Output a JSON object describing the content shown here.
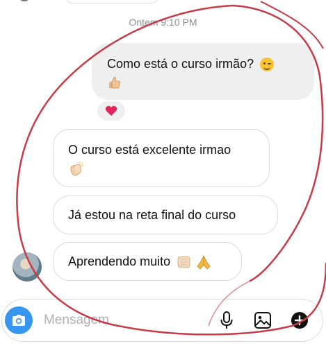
{
  "timestamp": "Ontem 9:10 PM",
  "messages": [
    {
      "direction": "sent",
      "text": "Como está o curso irmão?",
      "emojis": [
        "winking-face",
        "thumbs-up"
      ],
      "reaction": "red-heart"
    },
    {
      "direction": "received",
      "text": "O curso está excelente irmao",
      "emojis": [
        "clapping-hands"
      ]
    },
    {
      "direction": "received",
      "text": "Já estou na reta final do curso",
      "emojis": []
    },
    {
      "direction": "received",
      "text": "Aprendendo muito",
      "emojis": [
        "fist-bump",
        "folded-hands"
      ]
    }
  ],
  "composer": {
    "placeholder": "Mensagem",
    "value": ""
  },
  "colors": {
    "accent": "#3797f0",
    "sent_bubble": "#efefef",
    "heart": "#e0245e",
    "annotation": "#c93a46"
  },
  "icons": [
    "camera-icon",
    "microphone-icon",
    "gallery-icon",
    "plus-icon"
  ]
}
